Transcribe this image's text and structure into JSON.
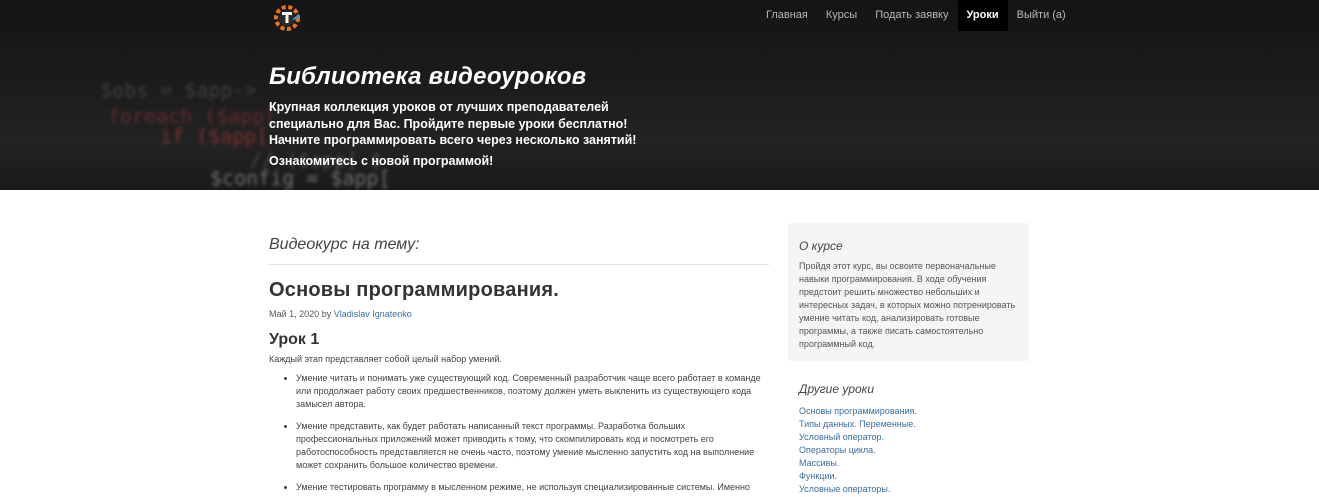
{
  "nav": {
    "items": [
      {
        "label": "Главная"
      },
      {
        "label": "Курсы"
      },
      {
        "label": "Подать заявку"
      },
      {
        "label": "Уроки"
      },
      {
        "label": "Выйти (a)"
      }
    ],
    "active_label": "Уроки"
  },
  "hero": {
    "title": "Библиотека видеоуроков",
    "description": "Крупная коллекция уроков от лучших преподавателей специально для Вас. Пройдите первые уроки бесплатно! Начните программировать всего через несколько занятий!",
    "link_text": "Ознакомитесь с новой программой!"
  },
  "main": {
    "section_heading": "Видеокурс на тему:",
    "post_title": "Основы программирования.",
    "post_date": "Май 1, 2020",
    "post_by": "by",
    "post_author": "Vladislav Ignatenko",
    "lesson_title": "Урок 1",
    "lesson_intro": "Каждый этап представляет собой целый набор умений.",
    "lesson_items": [
      "Умение читать и понимать уже существующий код. Современный разработчик чаще всего работает в команде или продолжает работу своих предшественников, поэтому должен уметь выкленить из существующего кода замысел автора.",
      "Умение представить, как будет работать написанный текст программы. Разработка больших профессиональных приложений может приводить к тому, что скомпилировать код и посмотреть его работоспособность представляется не очень часто, поэтому умение мысленно запустить код на выполнение может сохранить большое количество времени.",
      "Умение тестировать программу в мысленном режиме, не используя специализированные системы. Именно"
    ]
  },
  "sidebar": {
    "about_title": "О курсе",
    "about_text": "Пройдя этот курс, вы освоите первоначальные навыки программирования. В ходе обучения предстоит решить множество небольших и интересных задач, в которых можно потренировать умение читать код, анализировать готовые программы, а также писать самостоятельно программный код.",
    "other_title": "Другие уроки",
    "other_lessons": [
      "Основы программирования.",
      "Типы данных. Переменные.",
      "Условный оператор.",
      "Операторы цикла.",
      "Массивы.",
      "Функции.",
      "Условные операторы."
    ]
  },
  "colors": {
    "accent_link": "#3a6ea5",
    "hero_bg": "#1c1c1c",
    "active_nav_bg": "#000000",
    "logo_orange": "#e8751a",
    "logo_blue": "#2a9fd6"
  }
}
